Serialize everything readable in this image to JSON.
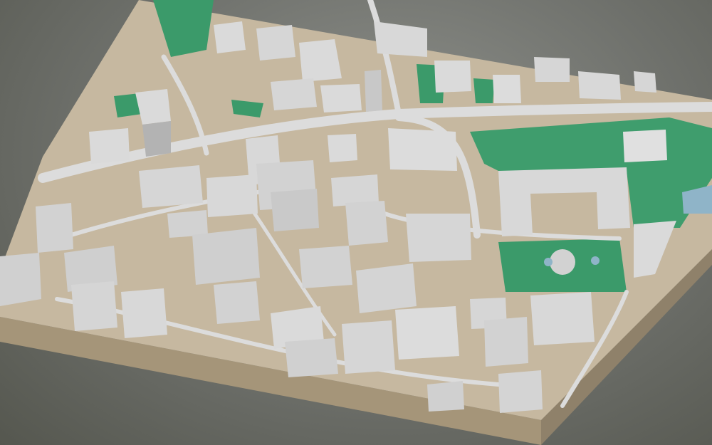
{
  "scene": {
    "type": "3d-city-model",
    "colors": {
      "background": "#75776f",
      "base_top": "#b9a88e",
      "base_side": "#a59579",
      "ground": "#c8bca8",
      "road": "#d2d2d2",
      "building_roof": "#d8d8d8",
      "building_side": "#b5b5b5",
      "building_shade": "#9e9e9e",
      "park": "#3b9a6a",
      "park_dark": "#2f8259",
      "water": "#8fb4c8"
    },
    "features": [
      "city-blocks",
      "street-network",
      "railway-corridor",
      "parks",
      "formal-garden",
      "pond"
    ]
  }
}
